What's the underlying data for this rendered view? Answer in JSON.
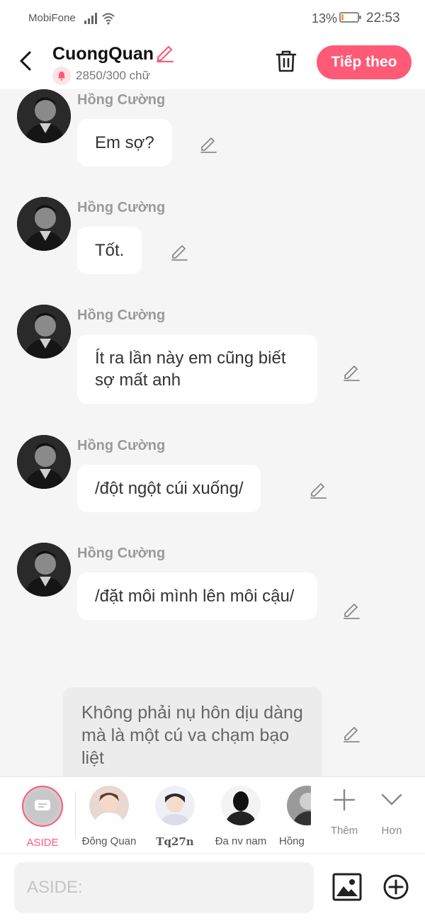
{
  "status_bar": {
    "carrier": "MobiFone",
    "battery_percent": "13%",
    "battery_level": 0.13,
    "time": "22:53"
  },
  "header": {
    "title": "CuongQuan",
    "counter": "2850/300 chữ",
    "next_label": "Tiếp theo",
    "accent_color": "#ff5a76"
  },
  "messages": [
    {
      "sender": "Hồng Cường",
      "text": "Em sợ?"
    },
    {
      "sender": "Hồng Cường",
      "text": "Tốt."
    },
    {
      "sender": "Hồng Cường",
      "text": "Ít ra lần này em cũng biết sợ mất anh"
    },
    {
      "sender": "Hồng Cường",
      "text": "/đột ngột cúi xuống/"
    },
    {
      "sender": "Hồng Cường",
      "text": "/đặt môi mình lên môi cậu/"
    }
  ],
  "aside_message": {
    "text": "Không phải nụ hôn dịu dàng mà là một cú va chạm bạo liệt"
  },
  "characters": [
    {
      "label": "ASIDE",
      "selected": true
    },
    {
      "label": "Đông Quan"
    },
    {
      "label": "Tq27n"
    },
    {
      "label": "Đa nv nam"
    },
    {
      "label": "Hồng"
    }
  ],
  "tools": {
    "add_label": "Thêm",
    "more_label": "Hơn"
  },
  "input": {
    "placeholder": "ASIDE:"
  },
  "icons": [
    "back-arrow-icon",
    "pencil-icon",
    "bell-icon",
    "trash-icon",
    "image-icon",
    "plus-circle-icon",
    "plus-icon",
    "chevron-down-icon"
  ]
}
